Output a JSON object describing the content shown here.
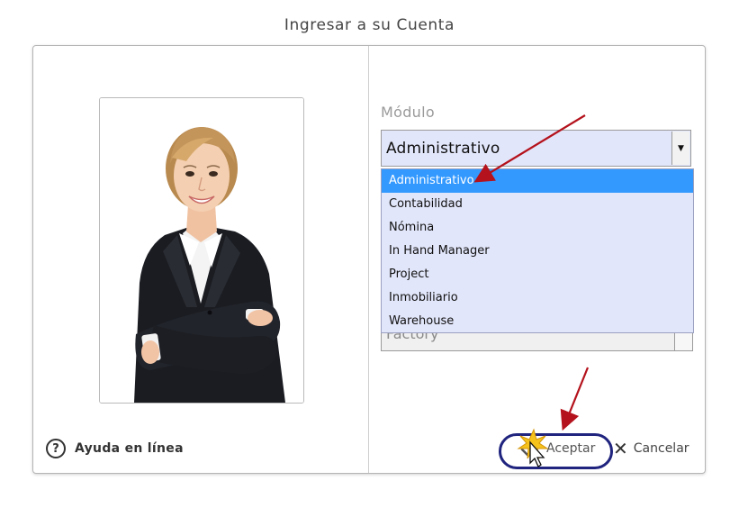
{
  "dialog": {
    "title": "Ingresar a su Cuenta"
  },
  "help": {
    "icon": "question-circle-icon",
    "label": "Ayuda en línea"
  },
  "module": {
    "label": "Módulo",
    "selected": "Administrativo",
    "options": [
      "Administrativo",
      "Contabilidad",
      "Nómina",
      "In Hand Manager",
      "Project",
      "Inmobiliario",
      "Warehouse"
    ],
    "highlighted_option": "Administrativo",
    "behind_field_value": "Factory"
  },
  "buttons": {
    "accept_label": "Aceptar",
    "cancel_label": "Cancelar"
  },
  "colors": {
    "select_bg": "#e2e6fa",
    "highlight_blue": "#3399ff",
    "annotation_arrow": "#b4121c",
    "annotation_ring": "#20247e"
  }
}
